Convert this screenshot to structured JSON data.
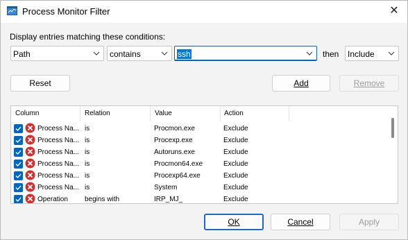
{
  "window": {
    "title": "Process Monitor Filter"
  },
  "filter": {
    "label": "Display entries matching these conditions:",
    "column": "Path",
    "relation": "contains",
    "value": "ssh",
    "then_label": "then",
    "action": "Include"
  },
  "buttons": {
    "reset": "Reset",
    "add": "Add",
    "remove": "Remove",
    "ok": "OK",
    "cancel": "Cancel",
    "apply": "Apply"
  },
  "list": {
    "headers": [
      "Column",
      "Relation",
      "Value",
      "Action"
    ],
    "rows": [
      {
        "column": "Process Na...",
        "relation": "is",
        "value": "Procmon.exe",
        "action": "Exclude"
      },
      {
        "column": "Process Na...",
        "relation": "is",
        "value": "Procexp.exe",
        "action": "Exclude"
      },
      {
        "column": "Process Na...",
        "relation": "is",
        "value": "Autoruns.exe",
        "action": "Exclude"
      },
      {
        "column": "Process Na...",
        "relation": "is",
        "value": "Procmon64.exe",
        "action": "Exclude"
      },
      {
        "column": "Process Na...",
        "relation": "is",
        "value": "Procexp64.exe",
        "action": "Exclude"
      },
      {
        "column": "Process Na...",
        "relation": "is",
        "value": "System",
        "action": "Exclude"
      },
      {
        "column": "Operation",
        "relation": "begins with",
        "value": "IRP_MJ_",
        "action": "Exclude"
      }
    ]
  },
  "colors": {
    "accent": "#0067c0",
    "exclude_icon": "#d32f2f"
  },
  "icons": {
    "check": "checkbox-checked-icon",
    "exclude": "exclude-x-icon",
    "chevron": "chevron-down-icon",
    "close": "close-icon",
    "app": "process-monitor-icon"
  }
}
